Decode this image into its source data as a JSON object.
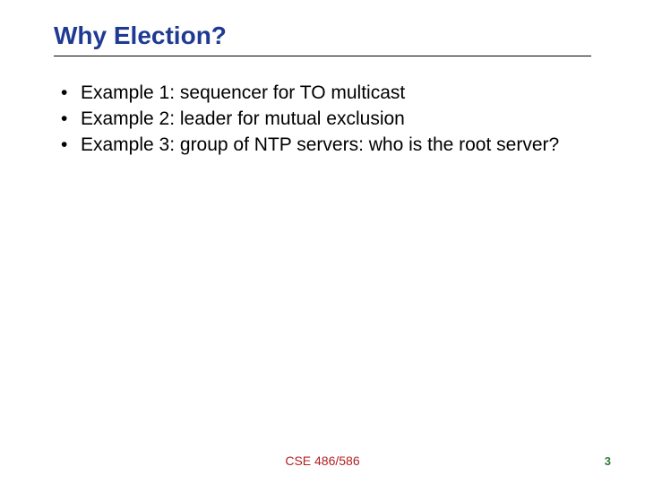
{
  "title": "Why Election?",
  "bullets": [
    "Example 1: sequencer for TO multicast",
    "Example 2: leader for mutual exclusion",
    "Example 3: group of NTP servers: who is the root server?"
  ],
  "footer_center": "CSE 486/586",
  "footer_right": "3"
}
